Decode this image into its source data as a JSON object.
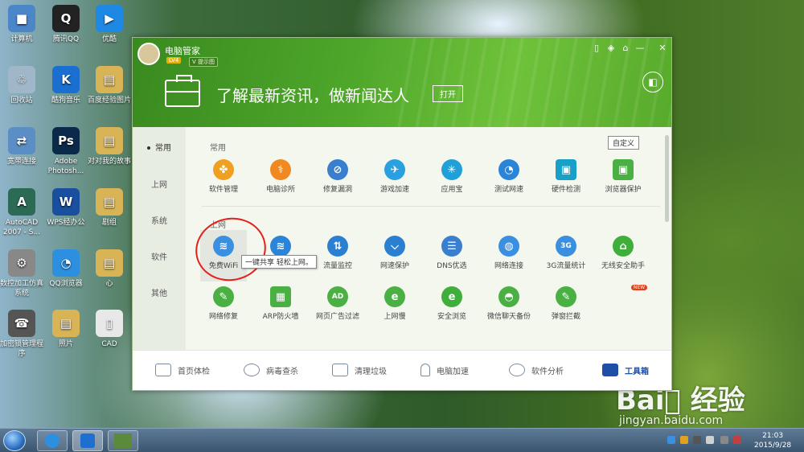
{
  "desktop_icons": [
    {
      "label": "计算机",
      "color": "#4a86c8",
      "glyph": "■"
    },
    {
      "label": "腾讯QQ",
      "color": "#222222",
      "glyph": "Q"
    },
    {
      "label": "优酷",
      "color": "#1e88e5",
      "glyph": "▶"
    },
    {
      "label": "回收站",
      "color": "#9fb7c9",
      "glyph": "♲"
    },
    {
      "label": "酷狗音乐",
      "color": "#1b6fd1",
      "glyph": "K"
    },
    {
      "label": "百度经验图片",
      "color": "#d9b457",
      "glyph": "▤"
    },
    {
      "label": "宽带连接",
      "color": "#5c8ec6",
      "glyph": "⇄"
    },
    {
      "label": "Adobe Photosh...",
      "color": "#0b2a4a",
      "glyph": "Ps"
    },
    {
      "label": "对对我的故事",
      "color": "#d9b457",
      "glyph": "▤"
    },
    {
      "label": "AutoCAD 2007 - S...",
      "color": "#2b6a55",
      "glyph": "A"
    },
    {
      "label": "WPS经办公",
      "color": "#1a4fa0",
      "glyph": "W"
    },
    {
      "label": "剧组",
      "color": "#d9b457",
      "glyph": "▤"
    },
    {
      "label": "数控加工仿真系统",
      "color": "#888888",
      "glyph": "⚙"
    },
    {
      "label": "QQ浏览器",
      "color": "#2d8fe0",
      "glyph": "◔"
    },
    {
      "label": "心",
      "color": "#d9b457",
      "glyph": "▤"
    },
    {
      "label": "加密锁管理程序",
      "color": "#555555",
      "glyph": "☎"
    },
    {
      "label": "照片",
      "color": "#d9b457",
      "glyph": "▤"
    },
    {
      "label": "CAD",
      "color": "#e8e8e8",
      "glyph": "▯"
    }
  ],
  "window": {
    "app_title": "电脑管家",
    "level_badge": "LV4",
    "vip_badge": "V 提示图",
    "controls": [
      "▯",
      "◈",
      "⌂",
      "—",
      "✕"
    ],
    "banner": {
      "headline": "了解最新资讯，做新闻达人",
      "open_label": "打开",
      "side_icon": "◧"
    },
    "nav": [
      {
        "label": "常用",
        "active": true
      },
      {
        "label": "上网",
        "active": false
      },
      {
        "label": "系统",
        "active": false
      },
      {
        "label": "软件",
        "active": false
      },
      {
        "label": "其他",
        "active": false
      }
    ],
    "customize_label": "自定义",
    "sections": [
      {
        "title": "常用",
        "tools": [
          {
            "label": "软件管理",
            "color": "#f0a020",
            "glyph": "✤"
          },
          {
            "label": "电脑诊所",
            "color": "#f08a20",
            "glyph": "⚕"
          },
          {
            "label": "修复漏洞",
            "color": "#3a7fcf",
            "glyph": "⊘"
          },
          {
            "label": "游戏加速",
            "color": "#2aa0e0",
            "glyph": "✈"
          },
          {
            "label": "应用宝",
            "color": "#1fa0d8",
            "glyph": "✳"
          },
          {
            "label": "测试网速",
            "color": "#2a84d8",
            "glyph": "◔"
          },
          {
            "label": "硬件检测",
            "color": "#18a0c8",
            "glyph": "▣"
          },
          {
            "label": "浏览器保护",
            "color": "#4bb043",
            "glyph": "▣"
          }
        ]
      },
      {
        "title": "上网",
        "tools": [
          {
            "label": "免费WiFi",
            "color": "#3a8fe0",
            "glyph": "≋"
          },
          {
            "label": "局域网测速",
            "color": "#2a84d8",
            "glyph": "≋"
          },
          {
            "label": "流量监控",
            "color": "#2a7fd0",
            "glyph": "⇅"
          },
          {
            "label": "网速保护",
            "color": "#2a7fd0",
            "glyph": "⌵"
          },
          {
            "label": "DNS优选",
            "color": "#3a7fcf",
            "glyph": "☰"
          },
          {
            "label": "网络连接",
            "color": "#3a8fe0",
            "glyph": "◍"
          },
          {
            "label": "3G流量统计",
            "color": "#3a8fe0",
            "glyph": "3G"
          },
          {
            "label": "无线安全助手",
            "color": "#3fae3a",
            "glyph": "⌂"
          },
          {
            "label": "网络修复",
            "color": "#4bb043",
            "glyph": "✎"
          },
          {
            "label": "ARP防火墙",
            "color": "#4bb043",
            "glyph": "▦"
          },
          {
            "label": "网页广告过滤",
            "color": "#4bb043",
            "glyph": "AD"
          },
          {
            "label": "上网慢",
            "color": "#4bb043",
            "glyph": "e"
          },
          {
            "label": "安全浏览",
            "color": "#3fae3a",
            "glyph": "e"
          },
          {
            "label": "微信聊天备份",
            "color": "#4bb043",
            "glyph": "◓"
          },
          {
            "label": "弹窗拦截",
            "color": "#4bb043",
            "glyph": "✎"
          }
        ]
      }
    ],
    "new_badge": "NEW",
    "tooltip": "一键共享 轻松上网。",
    "bottom_tabs": [
      {
        "label": "首页体检",
        "active": false
      },
      {
        "label": "病毒查杀",
        "active": false
      },
      {
        "label": "清理垃圾",
        "active": false
      },
      {
        "label": "电脑加速",
        "active": false
      },
      {
        "label": "软件分析",
        "active": false
      },
      {
        "label": "工具箱",
        "active": true
      }
    ]
  },
  "watermark": {
    "brand": "Bai⃝ 经验",
    "url": "jingyan.baidu.com"
  },
  "taskbar": {
    "time": "21:03",
    "date": "2015/9/28"
  }
}
